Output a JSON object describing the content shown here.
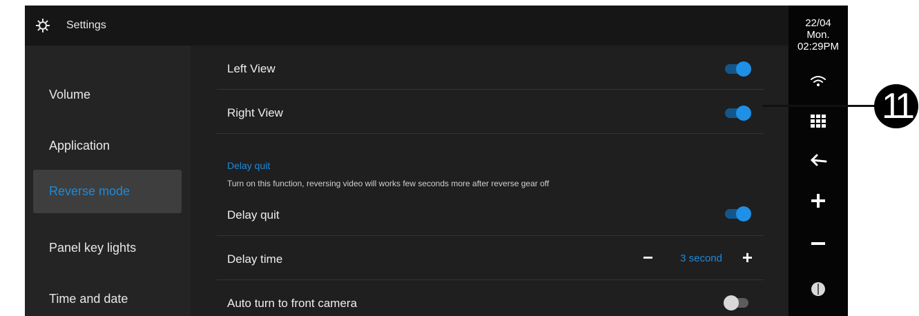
{
  "header": {
    "title": "Settings",
    "icon": "gear-icon"
  },
  "sidebar": {
    "items": [
      {
        "label": "Volume",
        "active": false
      },
      {
        "label": "Application",
        "active": false
      },
      {
        "label": "Reverse mode",
        "active": true
      },
      {
        "label": "Panel key lights",
        "active": false
      },
      {
        "label": "Time and date",
        "active": false
      }
    ]
  },
  "content": {
    "left_view": {
      "label": "Left View",
      "on": true
    },
    "right_view": {
      "label": "Right View",
      "on": true
    },
    "delay_section": {
      "title": "Delay quit",
      "description": "Turn on this function, reversing video will works few seconds more after reverse gear off"
    },
    "delay_quit": {
      "label": "Delay quit",
      "on": true
    },
    "delay_time": {
      "label": "Delay time",
      "minus": "−",
      "value": "3 second",
      "plus": "+"
    },
    "auto_front": {
      "label": "Auto turn to front camera",
      "on": false
    }
  },
  "statusbar": {
    "date": "22/04",
    "day": "Mon.",
    "time": "02:29PM",
    "icons": [
      "wifi-icon",
      "apps-grid-icon",
      "back-arrow-icon",
      "volume-up-icon",
      "volume-down-icon",
      "power-icon"
    ]
  },
  "callout": {
    "number": "11"
  },
  "colors": {
    "accent": "#1e8ad8",
    "background": "#1f1f1f",
    "sidebar_active": "#3e3e3e"
  }
}
